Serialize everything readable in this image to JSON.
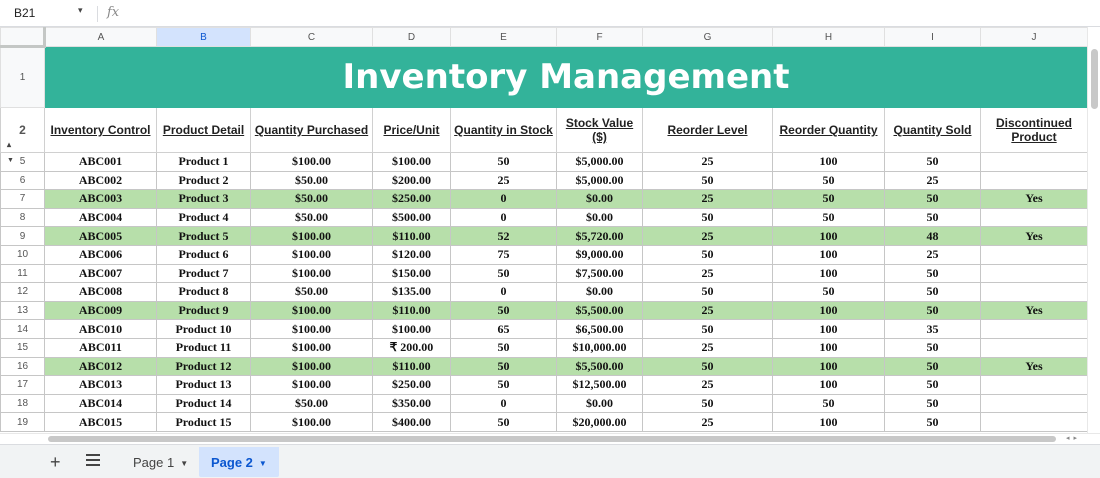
{
  "formula_bar": {
    "cell_ref": "B21",
    "fx_label": "fx"
  },
  "columns": [
    "A",
    "B",
    "C",
    "D",
    "E",
    "F",
    "G",
    "H",
    "I",
    "J"
  ],
  "selected_column": "B",
  "title_row": {
    "row": "1",
    "title": "Inventory Management"
  },
  "header_row": {
    "row": "2",
    "headers": [
      "Inventory Control",
      "Product Detail",
      "Quantity Purchased",
      "Price/Unit",
      "Quantity in Stock",
      "Stock Value ($)",
      "Reorder Level",
      "Reorder Quantity",
      "Quantity Sold",
      "Discontinued Product"
    ]
  },
  "rows": [
    {
      "row": "5",
      "cells": [
        "ABC001",
        "Product 1",
        "$100.00",
        "$100.00",
        "50",
        "$5,000.00",
        "25",
        "100",
        "50",
        ""
      ],
      "highlight": false
    },
    {
      "row": "6",
      "cells": [
        "ABC002",
        "Product 2",
        "$50.00",
        "$200.00",
        "25",
        "$5,000.00",
        "50",
        "50",
        "25",
        ""
      ],
      "highlight": false
    },
    {
      "row": "7",
      "cells": [
        "ABC003",
        "Product 3",
        "$50.00",
        "$250.00",
        "0",
        "$0.00",
        "25",
        "50",
        "50",
        "Yes"
      ],
      "highlight": true
    },
    {
      "row": "8",
      "cells": [
        "ABC004",
        "Product 4",
        "$50.00",
        "$500.00",
        "0",
        "$0.00",
        "50",
        "50",
        "50",
        ""
      ],
      "highlight": false
    },
    {
      "row": "9",
      "cells": [
        "ABC005",
        "Product 5",
        "$100.00",
        "$110.00",
        "52",
        "$5,720.00",
        "25",
        "100",
        "48",
        "Yes"
      ],
      "highlight": true
    },
    {
      "row": "10",
      "cells": [
        "ABC006",
        "Product 6",
        "$100.00",
        "$120.00",
        "75",
        "$9,000.00",
        "50",
        "100",
        "25",
        ""
      ],
      "highlight": false
    },
    {
      "row": "11",
      "cells": [
        "ABC007",
        "Product 7",
        "$100.00",
        "$150.00",
        "50",
        "$7,500.00",
        "25",
        "100",
        "50",
        ""
      ],
      "highlight": false
    },
    {
      "row": "12",
      "cells": [
        "ABC008",
        "Product 8",
        "$50.00",
        "$135.00",
        "0",
        "$0.00",
        "50",
        "50",
        "50",
        ""
      ],
      "highlight": false
    },
    {
      "row": "13",
      "cells": [
        "ABC009",
        "Product 9",
        "$100.00",
        "$110.00",
        "50",
        "$5,500.00",
        "25",
        "100",
        "50",
        "Yes"
      ],
      "highlight": true
    },
    {
      "row": "14",
      "cells": [
        "ABC010",
        "Product 10",
        "$100.00",
        "$100.00",
        "65",
        "$6,500.00",
        "50",
        "100",
        "35",
        ""
      ],
      "highlight": false
    },
    {
      "row": "15",
      "cells": [
        "ABC011",
        "Product 11",
        "$100.00",
        "₹ 200.00",
        "50",
        "$10,000.00",
        "25",
        "100",
        "50",
        ""
      ],
      "highlight": false
    },
    {
      "row": "16",
      "cells": [
        "ABC012",
        "Product 12",
        "$100.00",
        "$110.00",
        "50",
        "$5,500.00",
        "50",
        "100",
        "50",
        "Yes"
      ],
      "highlight": true
    },
    {
      "row": "17",
      "cells": [
        "ABC013",
        "Product 13",
        "$100.00",
        "$250.00",
        "50",
        "$12,500.00",
        "25",
        "100",
        "50",
        ""
      ],
      "highlight": false
    },
    {
      "row": "18",
      "cells": [
        "ABC014",
        "Product 14",
        "$50.00",
        "$350.00",
        "0",
        "$0.00",
        "50",
        "50",
        "50",
        ""
      ],
      "highlight": false
    },
    {
      "row": "19",
      "cells": [
        "ABC015",
        "Product 15",
        "$100.00",
        "$400.00",
        "50",
        "$20,000.00",
        "25",
        "100",
        "50",
        ""
      ],
      "highlight": false
    }
  ],
  "sheet_tabs": [
    {
      "label": "Page 1",
      "active": false
    },
    {
      "label": "Page 2",
      "active": true
    }
  ],
  "icons": {
    "add_sheet": "plus-icon",
    "all_sheets": "menu-icon",
    "tab_menu": "caret-down-icon"
  },
  "colors": {
    "title_bg": "#33b39a",
    "highlight_row": "#b7dfaa",
    "active_tab_bg": "#d3e3fd",
    "active_tab_text": "#0b57d0"
  }
}
